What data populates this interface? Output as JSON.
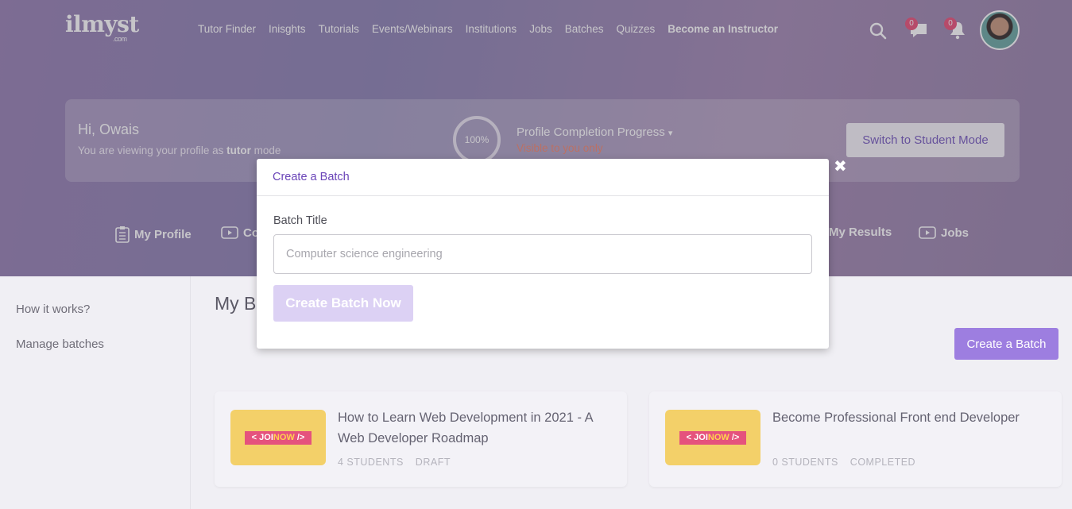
{
  "header": {
    "logo": "ilmyst",
    "logo_sub": ".com",
    "nav": [
      "Tutor Finder",
      "Inisghts",
      "Tutorials",
      "Events/Webinars",
      "Institutions",
      "Jobs",
      "Batches",
      "Quizzes",
      "Become an Instructor"
    ],
    "messages_count": "0",
    "notifications_count": "0"
  },
  "profile": {
    "greeting": "Hi, Owais",
    "mode_prefix": "You are viewing your profile as",
    "mode_role": "tutor",
    "mode_suffix": "mode",
    "progress_value": "100%",
    "progress_title": "Profile Completion Progress",
    "progress_sub": "Visible to you only",
    "switch_label": "Switch to Student Mode"
  },
  "tabs": {
    "profile": "My Profile",
    "courses": "Co",
    "results": "My Results",
    "jobs": "Jobs"
  },
  "sidebar": {
    "items": [
      "How it works?",
      "Manage batches"
    ]
  },
  "main": {
    "title": "My B",
    "create_label": "Create a Batch",
    "batches": [
      {
        "title": "How to Learn Web Development in 2021 - A Web Developer Roadmap",
        "students": "4 STUDENTS",
        "status": "DRAFT",
        "thumb_text": "< JOI",
        "thumb_accent": "NOW",
        "thumb_end": " />"
      },
      {
        "title": "Become Professional Front end Developer",
        "students": "0 STUDENTS",
        "status": "COMPLETED",
        "thumb_text": "< JOI",
        "thumb_accent": "NOW",
        "thumb_end": " />"
      }
    ]
  },
  "modal": {
    "title": "Create a Batch",
    "field_label": "Batch Title",
    "field_placeholder": "Computer science engineering",
    "submit_label": "Create Batch Now",
    "close_symbol": "✖"
  },
  "colors": {
    "accent": "#9d7ee0",
    "modal_title": "#6a44b8",
    "badge": "#e9577c",
    "warning_text": "#f08a74"
  }
}
